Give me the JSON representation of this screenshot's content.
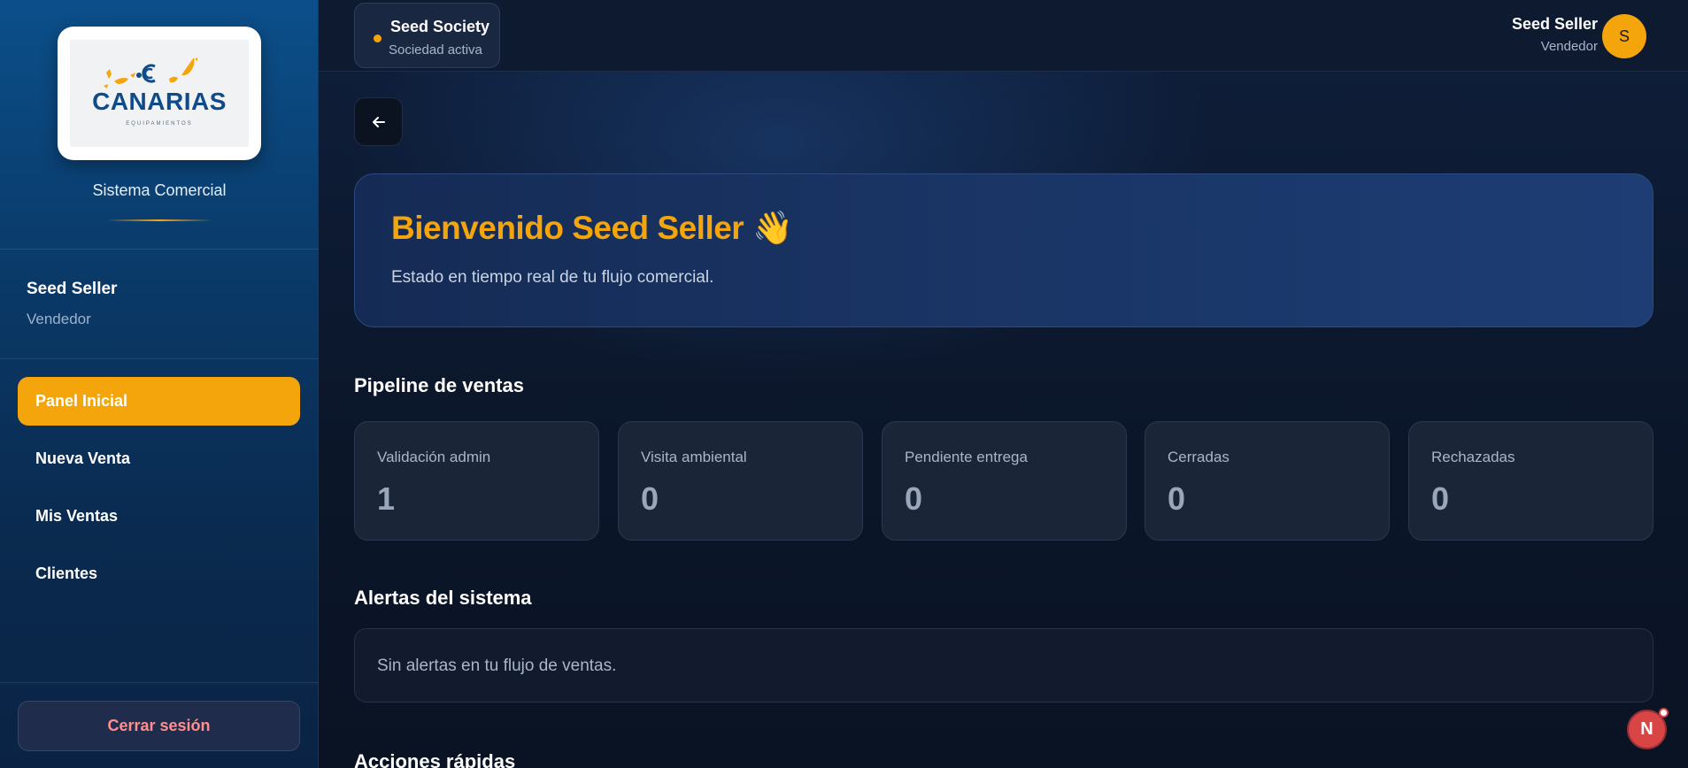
{
  "sidebar": {
    "logo": {
      "text": "CANARIAS",
      "subtext": "EQUIPAMIENTOS"
    },
    "system_name": "Sistema Comercial",
    "user": {
      "name": "Seed Seller",
      "role": "Vendedor"
    },
    "nav": [
      {
        "label": "Panel Inicial",
        "active": true
      },
      {
        "label": "Nueva Venta",
        "active": false
      },
      {
        "label": "Mis Ventas",
        "active": false
      },
      {
        "label": "Clientes",
        "active": false
      }
    ],
    "logout_label": "Cerrar sesión"
  },
  "topbar": {
    "society_name": "Seed Society",
    "society_status": "Sociedad activa",
    "user_name": "Seed Seller",
    "user_role": "Vendedor",
    "avatar_initial": "S"
  },
  "main": {
    "hero_title": "Bienvenido Seed Seller 👋",
    "hero_subtitle": "Estado en tiempo real de tu flujo comercial.",
    "pipeline_title": "Pipeline de ventas",
    "pipeline": [
      {
        "label": "Validación admin",
        "value": "1"
      },
      {
        "label": "Visita ambiental",
        "value": "0"
      },
      {
        "label": "Pendiente entrega",
        "value": "0"
      },
      {
        "label": "Cerradas",
        "value": "0"
      },
      {
        "label": "Rechazadas",
        "value": "0"
      }
    ],
    "alerts_title": "Alertas del sistema",
    "alerts_text": "Sin alertas en tu flujo de ventas.",
    "quick_actions_title": "Acciones rápidas"
  },
  "floating_badge": "N",
  "colors": {
    "accent": "#f5a50c",
    "logout_text": "#ff8e8e",
    "badge": "#d94545",
    "logo_blue": "#0f4a8a"
  }
}
